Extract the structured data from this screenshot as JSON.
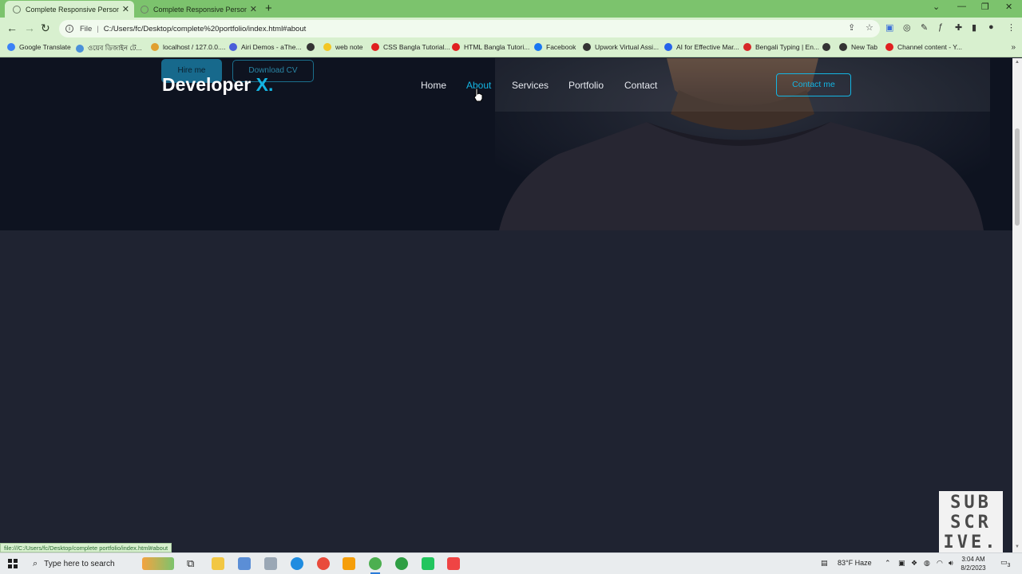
{
  "browser": {
    "tabs": [
      {
        "title": "Complete Responsive Personal P",
        "active": true
      },
      {
        "title": "Complete Responsive Personal P",
        "active": false
      }
    ],
    "url_scheme": "File",
    "url": "C:/Users/fc/Desktop/complete%20portfolio/index.html#about",
    "bookmarks": [
      {
        "label": "Google Translate",
        "color": "#3b82f6"
      },
      {
        "label": "ওয়েব ডিজাইন টে...",
        "color": "#4a90d9"
      },
      {
        "label": "localhost / 127.0.0....",
        "color": "#e0a030"
      },
      {
        "label": "Airi Demos - aThe...",
        "color": "#4a5fd9"
      },
      {
        "label": "",
        "color": "#333333"
      },
      {
        "label": "web note",
        "color": "#f3c623"
      },
      {
        "label": "CSS Bangla Tutorial...",
        "color": "#e02020"
      },
      {
        "label": "HTML Bangla Tutori...",
        "color": "#e02020"
      },
      {
        "label": "Facebook",
        "color": "#1877f2"
      },
      {
        "label": "Upwork Virtual Assi...",
        "color": "#333333"
      },
      {
        "label": "AI for Effective Mar...",
        "color": "#2563eb"
      },
      {
        "label": "Bengali Typing | En...",
        "color": "#d62828"
      },
      {
        "label": "",
        "color": "#333333"
      },
      {
        "label": "New Tab",
        "color": "#333333"
      },
      {
        "label": "Channel content - Y...",
        "color": "#e02020"
      }
    ],
    "status_url": "file:///C:/Users/fc/Desktop/complete portfolio/index.html#about"
  },
  "site": {
    "logo_text": "Developer",
    "logo_accent": "X.",
    "nav": [
      {
        "label": "Home",
        "active": false
      },
      {
        "label": "About",
        "active": true
      },
      {
        "label": "Services",
        "active": false
      },
      {
        "label": "Portfolio",
        "active": false
      },
      {
        "label": "Contact",
        "active": false
      }
    ],
    "hire_button": "Hire me",
    "cv_button": "Download CV",
    "contact_button": "Contact me",
    "accent_color": "#14b5e3"
  },
  "overlay": {
    "subscribe_lines": [
      "SUB",
      "SCR",
      "IVE."
    ]
  },
  "taskbar": {
    "search_placeholder": "Type here to search",
    "weather": "83°F  Haze",
    "time": "3:04 AM",
    "date": "8/2/2023",
    "notification_count": "3"
  }
}
